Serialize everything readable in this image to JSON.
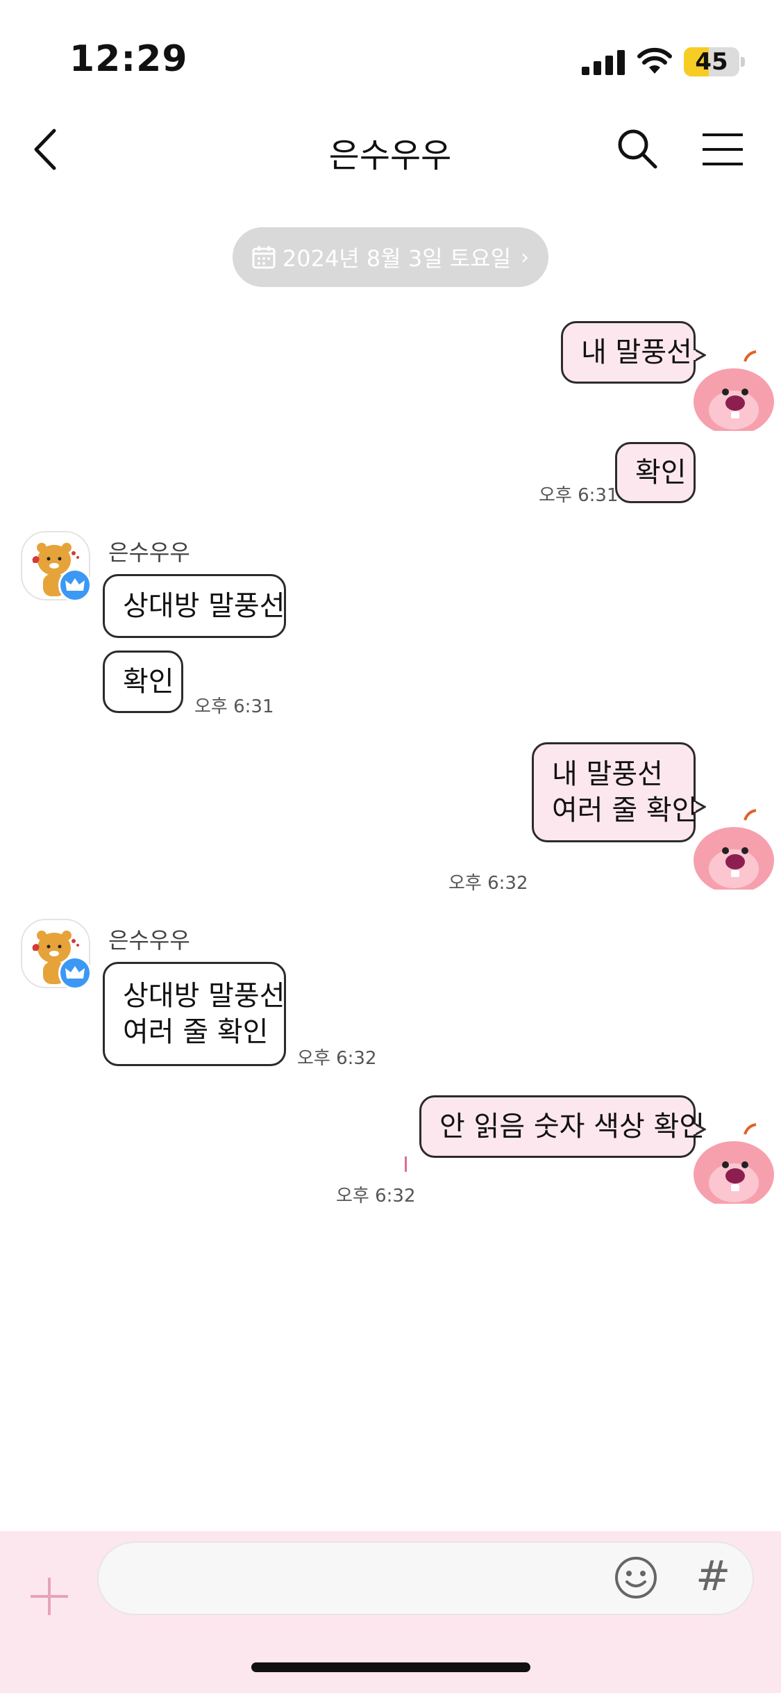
{
  "status_bar": {
    "time": "12:29",
    "battery": "45",
    "battery_level": 0.45
  },
  "nav": {
    "title": "은수우우"
  },
  "date_chip": {
    "text": "2024년 8월 3일 토요일"
  },
  "messages": [
    {
      "lines": [
        "내 말풍선"
      ]
    },
    {
      "lines": [
        "확인"
      ],
      "time": "오후 6:31"
    },
    {
      "sender": "은수우우",
      "lines": [
        "상대방 말풍선"
      ]
    },
    {
      "lines": [
        "확인"
      ],
      "time": "오후 6:31"
    },
    {
      "lines": [
        "내 말풍선",
        "여러 줄 확인"
      ],
      "time": "오후 6:32"
    },
    {
      "sender": "은수우우",
      "lines": [
        "상대방 말풍선",
        "여러 줄 확인"
      ],
      "time": "오후 6:32"
    },
    {
      "lines": [
        "안 읽음 숫자 색상 확인"
      ],
      "time": "오후 6:32"
    }
  ],
  "input": {
    "placeholder": "",
    "value": ""
  },
  "colors": {
    "my_bubble": "#fde7ee",
    "their_bubble": "#ffffff",
    "input_bar": "#fde7ee",
    "date_chip": "#d9d9d9",
    "unread_mark": "#e06a91"
  }
}
